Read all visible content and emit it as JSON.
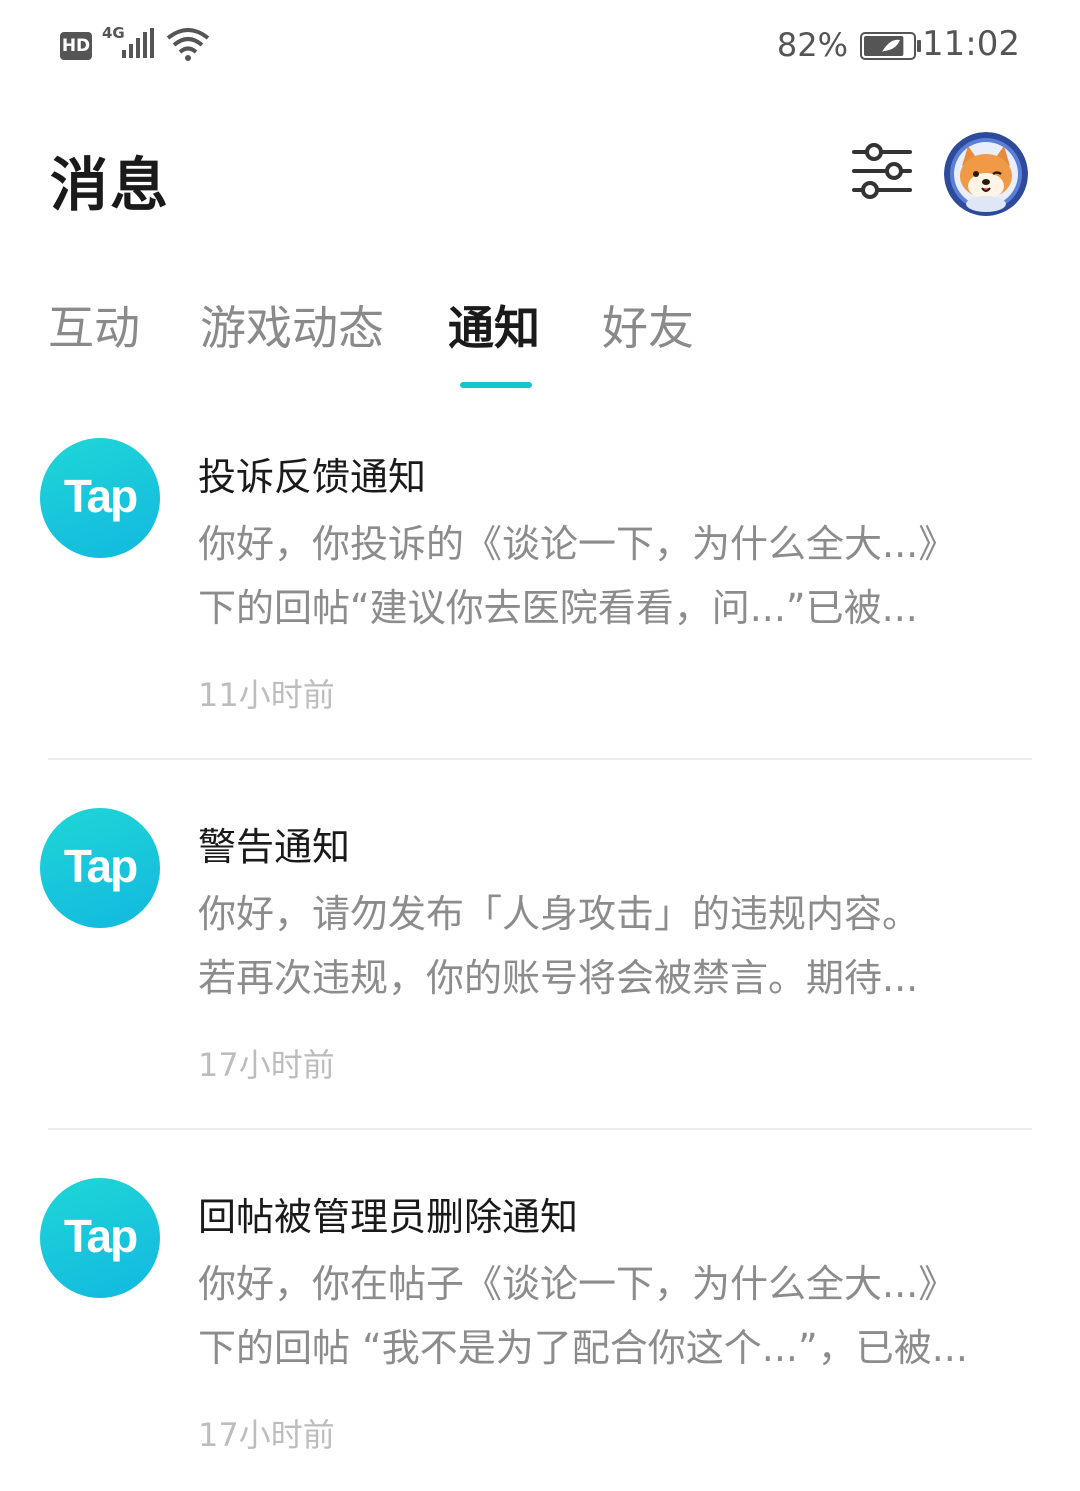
{
  "status_bar": {
    "hd_label": "HD",
    "network_label": "4G",
    "battery_percent": "82%",
    "time": "11:02",
    "battery_level": 0.82
  },
  "header": {
    "title": "消息",
    "filter_icon": "sliders-icon",
    "avatar_icon": "shiba-dog-avatar"
  },
  "tabs": [
    {
      "label": "互动",
      "active": false
    },
    {
      "label": "游戏动态",
      "active": false
    },
    {
      "label": "通知",
      "active": true
    },
    {
      "label": "好友",
      "active": false
    }
  ],
  "accent_color": "#15c5ce",
  "notifications": [
    {
      "logo_text": "Tap",
      "title": "投诉反馈通知",
      "line1": "你好，你投诉的《谈论一下，为什么全大...》",
      "line2": "下的回帖“建议你去医院看看，问...”已被...",
      "time": "11小时前"
    },
    {
      "logo_text": "Tap",
      "title": "警告通知",
      "line1": "你好，请勿发布「人身攻击」的违规内容。",
      "line2": "若再次违规，你的账号将会被禁言。期待...",
      "time": "17小时前"
    },
    {
      "logo_text": "Tap",
      "title": "回帖被管理员删除通知",
      "line1": "你好，你在帖子《谈论一下，为什么全大...》",
      "line2": "下的回帖 “我不是为了配合你这个...”，已被...",
      "time": "17小时前"
    }
  ]
}
